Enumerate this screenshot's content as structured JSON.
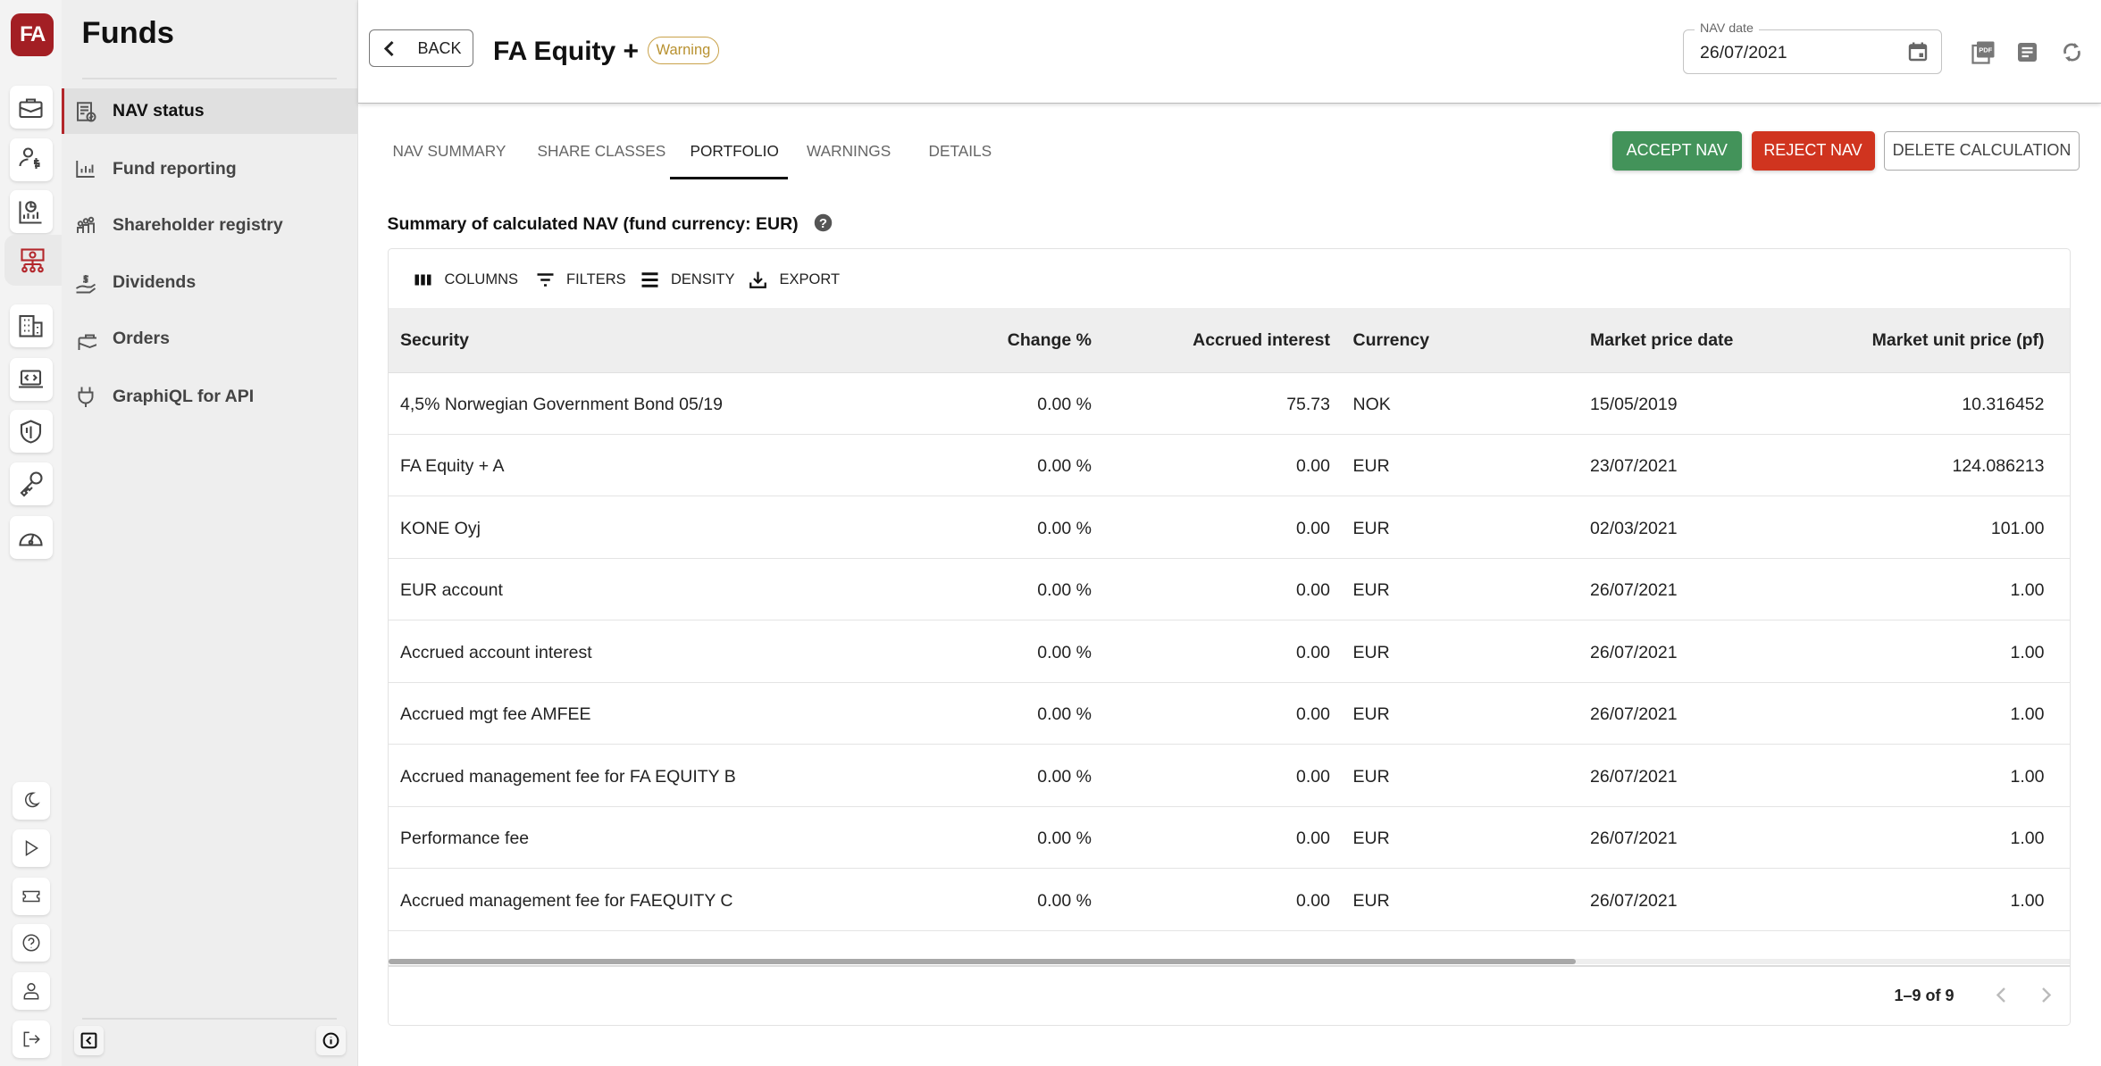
{
  "logo": "FA",
  "rail": {
    "top_icons": [
      "briefcase-icon",
      "user-dollar-icon",
      "report-chart-icon",
      "funds-network-icon",
      "building-icon",
      "laptop-code-icon",
      "shield-icon",
      "key-icon",
      "speedometer-icon"
    ],
    "active_index": 3,
    "bottom_icons": [
      "moon-icon",
      "play-icon",
      "ticket-icon",
      "help-icon",
      "user-icon",
      "logout-icon"
    ]
  },
  "nav": {
    "title": "Funds",
    "items": [
      {
        "label": "NAV status",
        "icon": "nav-status-icon",
        "active": true
      },
      {
        "label": "Fund reporting",
        "icon": "bar-chart-icon"
      },
      {
        "label": "Shareholder registry",
        "icon": "people-icon"
      },
      {
        "label": "Dividends",
        "icon": "hand-dollar-icon"
      },
      {
        "label": "Orders",
        "icon": "briefcase-icon"
      },
      {
        "label": "GraphiQL for API",
        "icon": "plug-icon"
      }
    ]
  },
  "header": {
    "back_label": "BACK",
    "title": "FA Equity +",
    "status_badge": "Warning",
    "nav_date_label": "NAV date",
    "nav_date_value": "26/07/2021"
  },
  "tabs": [
    "NAV SUMMARY",
    "SHARE CLASSES",
    "PORTFOLIO",
    "WARNINGS",
    "DETAILS"
  ],
  "active_tab": "PORTFOLIO",
  "actions": {
    "accept": "ACCEPT NAV",
    "reject": "REJECT NAV",
    "delete": "DELETE CALCULATION"
  },
  "colors": {
    "accept": "#43935a",
    "reject": "#d0341f",
    "brand": "#a31f24",
    "warning": "#c9a24a"
  },
  "summary_title": "Summary of calculated NAV (fund currency: EUR)",
  "toolbar": {
    "columns": "COLUMNS",
    "filters": "FILTERS",
    "density": "DENSITY",
    "export": "EXPORT"
  },
  "table": {
    "columns": [
      "Security",
      "Change %",
      "Accrued interest",
      "Currency",
      "Market price date",
      "Market unit price (pf)"
    ],
    "rows": [
      [
        "4,5% Norwegian Government Bond 05/19",
        "0.00 %",
        "75.73",
        "NOK",
        "15/05/2019",
        "10.316452"
      ],
      [
        "FA Equity + A",
        "0.00 %",
        "0.00",
        "EUR",
        "23/07/2021",
        "124.086213"
      ],
      [
        "KONE Oyj",
        "0.00 %",
        "0.00",
        "EUR",
        "02/03/2021",
        "101.00"
      ],
      [
        "EUR account",
        "0.00 %",
        "0.00",
        "EUR",
        "26/07/2021",
        "1.00"
      ],
      [
        "Accrued account interest",
        "0.00 %",
        "0.00",
        "EUR",
        "26/07/2021",
        "1.00"
      ],
      [
        "Accrued mgt fee AMFEE",
        "0.00 %",
        "0.00",
        "EUR",
        "26/07/2021",
        "1.00"
      ],
      [
        "Accrued management fee for FA EQUITY B",
        "0.00 %",
        "0.00",
        "EUR",
        "26/07/2021",
        "1.00"
      ],
      [
        "Performance fee",
        "0.00 %",
        "0.00",
        "EUR",
        "26/07/2021",
        "1.00"
      ],
      [
        "Accrued management fee for FAEQUITY C",
        "0.00 %",
        "0.00",
        "EUR",
        "26/07/2021",
        "1.00"
      ]
    ],
    "pagination": "1–9 of 9"
  }
}
